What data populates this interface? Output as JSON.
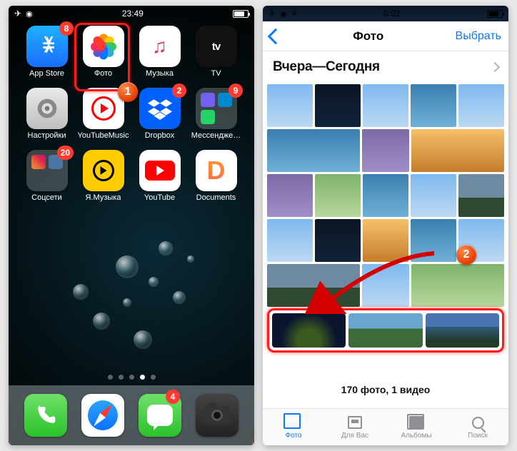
{
  "left": {
    "status": {
      "time": "23:49"
    },
    "apps": [
      {
        "name": "appstore",
        "label": "App Store",
        "badge": "8"
      },
      {
        "name": "photos",
        "label": "Фото"
      },
      {
        "name": "music",
        "label": "Музыка"
      },
      {
        "name": "tv",
        "label": "TV"
      },
      {
        "name": "settings",
        "label": "Настройки"
      },
      {
        "name": "ytmusic",
        "label": "YouTubeMusic"
      },
      {
        "name": "dropbox",
        "label": "Dropbox",
        "badge": "2"
      },
      {
        "name": "messengers",
        "label": "Мессендже…",
        "badge": "9"
      },
      {
        "name": "social",
        "label": "Соцсети",
        "badge": "20"
      },
      {
        "name": "ymusic",
        "label": "Я.Музыка"
      },
      {
        "name": "youtube",
        "label": "YouTube"
      },
      {
        "name": "documents",
        "label": "Documents"
      }
    ],
    "dock": [
      {
        "name": "phone"
      },
      {
        "name": "safari"
      },
      {
        "name": "messages",
        "badge": "4"
      },
      {
        "name": "camera"
      }
    ],
    "tv_text": "tv",
    "callouts": {
      "one": "1"
    }
  },
  "right": {
    "status": {
      "time": "0:02"
    },
    "nav": {
      "title": "Фото",
      "action": "Выбрать"
    },
    "section": {
      "title": "Вчера—Сегодня"
    },
    "summary": "170 фото, 1 видео",
    "tabs": [
      {
        "name": "photos",
        "label": "Фото",
        "active": true
      },
      {
        "name": "for-you",
        "label": "Для Вас"
      },
      {
        "name": "albums",
        "label": "Альбомы"
      },
      {
        "name": "search",
        "label": "Поиск"
      }
    ],
    "callouts": {
      "two": "2"
    }
  }
}
